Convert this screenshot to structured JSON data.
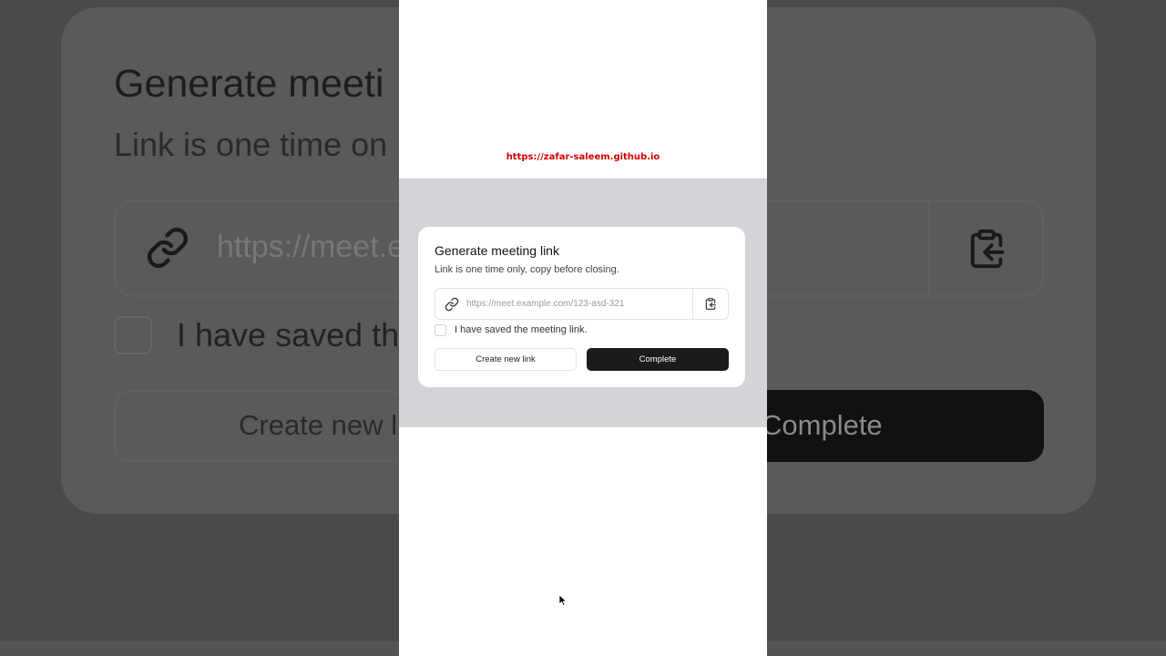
{
  "dialog": {
    "title": "Generate meeting link",
    "subtitle": "Link is one time only, copy before closing.",
    "url_placeholder": "https://meet.example.com/123-asd-321",
    "checkbox_label": "I have saved the meeting link.",
    "create_button_label": "Create new link",
    "complete_button_label": "Complete"
  },
  "background": {
    "title": "Generate meeti",
    "subtitle": "Link is one time on",
    "url": "https://meet.e",
    "checkbox_label": "I have saved th",
    "create_button_label": "Create new l",
    "complete_button_label": "Complete"
  },
  "watermark": "https://zafar-saleem.github.io",
  "icons": {
    "link": "link-icon",
    "paste": "clipboard-paste-icon",
    "cursor": "mouse-pointer-icon"
  },
  "colors": {
    "overlay": "#d4d3d8",
    "dark_button": "#1b1b1b",
    "watermark": "#d40000"
  }
}
